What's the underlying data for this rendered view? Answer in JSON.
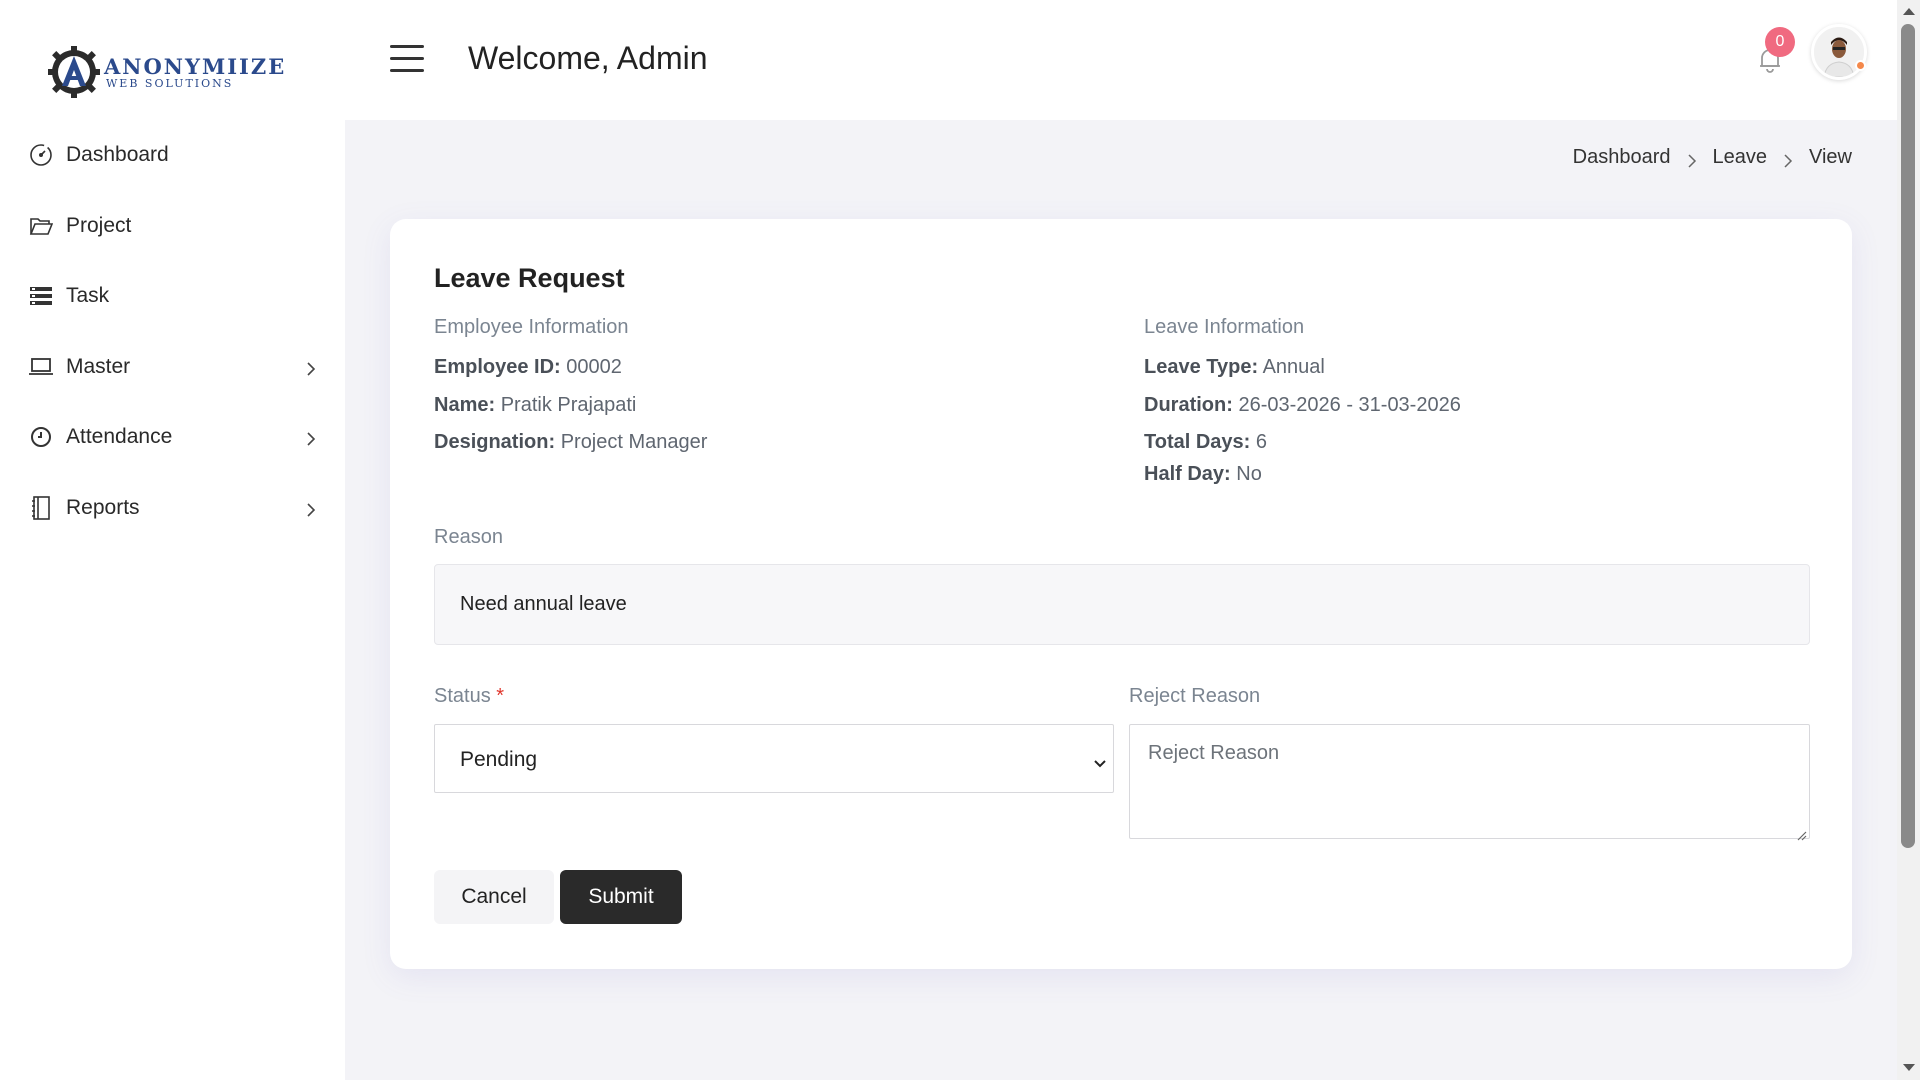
{
  "brand": {
    "title": "ANONYMIIZE",
    "subtitle": "WEB SOLUTIONS"
  },
  "sidebar": {
    "items": [
      {
        "label": "Dashboard",
        "icon": "dashboard-gauge-icon",
        "has_children": false
      },
      {
        "label": "Project",
        "icon": "folder-open-icon",
        "has_children": false
      },
      {
        "label": "Task",
        "icon": "tasks-list-icon",
        "has_children": false
      },
      {
        "label": "Master",
        "icon": "laptop-icon",
        "has_children": true
      },
      {
        "label": "Attendance",
        "icon": "clock-icon",
        "has_children": true
      },
      {
        "label": "Reports",
        "icon": "notebook-icon",
        "has_children": true
      }
    ]
  },
  "header": {
    "welcome": "Welcome, Admin",
    "notification_count": "0",
    "colors": {
      "badge": "#f06a80",
      "presence": "#f4884a"
    }
  },
  "breadcrumb": [
    "Dashboard",
    "Leave",
    "View"
  ],
  "card": {
    "title": "Leave Request",
    "employee": {
      "heading": "Employee Information",
      "id_label": "Employee ID:",
      "id_value": "00002",
      "name_label": "Name:",
      "name_value": "Pratik Prajapati",
      "designation_label": "Designation:",
      "designation_value": "Project Manager"
    },
    "leave": {
      "heading": "Leave Information",
      "type_label": "Leave Type:",
      "type_value": "Annual",
      "duration_label": "Duration:",
      "duration_value": "26-03-2026 - 31-03-2026",
      "total_label": "Total Days:",
      "total_value": "6",
      "half_label": "Half Day:",
      "half_value": "No"
    },
    "reason": {
      "label": "Reason",
      "value": "Need annual leave"
    },
    "status": {
      "label": "Status",
      "required_mark": "*",
      "selected": "Pending"
    },
    "reject_reason": {
      "label": "Reject Reason",
      "placeholder": "Reject Reason"
    },
    "buttons": {
      "cancel": "Cancel",
      "submit": "Submit"
    }
  }
}
